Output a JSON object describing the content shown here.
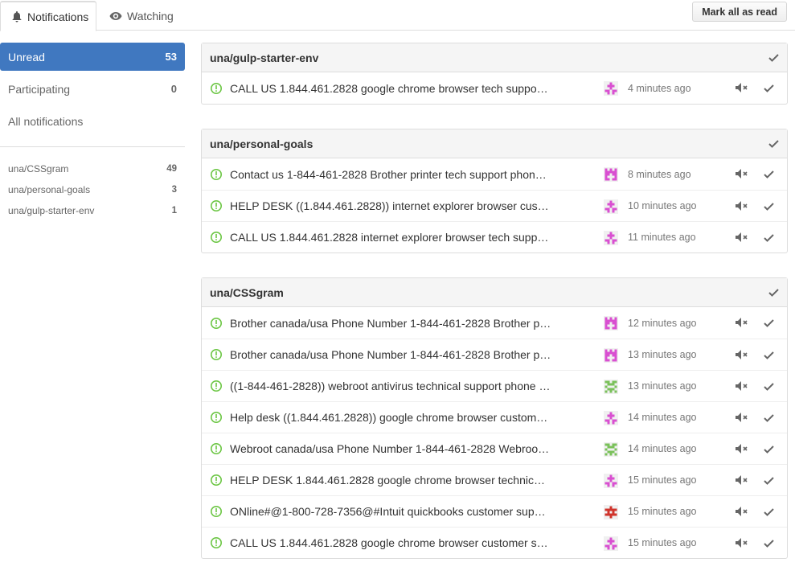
{
  "tabs": {
    "notifications": "Notifications",
    "watching": "Watching"
  },
  "mark_all_label": "Mark all as read",
  "sidebar": {
    "filters": [
      {
        "label": "Unread",
        "count": "53"
      },
      {
        "label": "Participating",
        "count": "0"
      },
      {
        "label": "All notifications",
        "count": ""
      }
    ],
    "repos": [
      {
        "label": "una/CSSgram",
        "count": "49"
      },
      {
        "label": "una/personal-goals",
        "count": "3"
      },
      {
        "label": "una/gulp-starter-env",
        "count": "1"
      }
    ]
  },
  "colors": {
    "accent": "#4078c0",
    "issue_open": "#6cc644",
    "avatar_pink": "#d94fd1",
    "avatar_green": "#7ac15a",
    "avatar_red": "#d0342c"
  },
  "groups": [
    {
      "repo": "una/gulp-starter-env",
      "items": [
        {
          "title": "CALL US 1.844.461.2828 google chrome browser tech suppo…",
          "time": "4 minutes ago",
          "avatar": "pink-pattern-a"
        }
      ]
    },
    {
      "repo": "una/personal-goals",
      "items": [
        {
          "title": "Contact us 1-844-461-2828 Brother printer tech support phon…",
          "time": "8 minutes ago",
          "avatar": "pink-pattern-b"
        },
        {
          "title": "HELP DESK ((1.844.461.2828)) internet explorer browser cus…",
          "time": "10 minutes ago",
          "avatar": "pink-pattern-a"
        },
        {
          "title": "CALL US 1.844.461.2828 internet explorer browser tech supp…",
          "time": "11 minutes ago",
          "avatar": "pink-pattern-a"
        }
      ]
    },
    {
      "repo": "una/CSSgram",
      "items": [
        {
          "title": "Brother canada/usa Phone Number 1-844-461-2828 Brother p…",
          "time": "12 minutes ago",
          "avatar": "pink-pattern-b"
        },
        {
          "title": "Brother canada/usa Phone Number 1-844-461-2828 Brother p…",
          "time": "13 minutes ago",
          "avatar": "pink-pattern-b"
        },
        {
          "title": "((1-844-461-2828)) webroot antivirus technical support phone …",
          "time": "13 minutes ago",
          "avatar": "green-pattern"
        },
        {
          "title": "Help desk ((1.844.461.2828)) google chrome browser custom…",
          "time": "14 minutes ago",
          "avatar": "pink-pattern-a"
        },
        {
          "title": "Webroot canada/usa Phone Number 1-844-461-2828 Webroo…",
          "time": "14 minutes ago",
          "avatar": "green-pattern"
        },
        {
          "title": "HELP DESK 1.844.461.2828 google chrome browser technic…",
          "time": "15 minutes ago",
          "avatar": "pink-pattern-a"
        },
        {
          "title": "ONline#@1-800-728-7356@#Intuit quickbooks customer sup…",
          "time": "15 minutes ago",
          "avatar": "red-pattern"
        },
        {
          "title": "CALL US 1.844.461.2828 google chrome browser customer s…",
          "time": "15 minutes ago",
          "avatar": "pink-pattern-a"
        }
      ]
    }
  ]
}
